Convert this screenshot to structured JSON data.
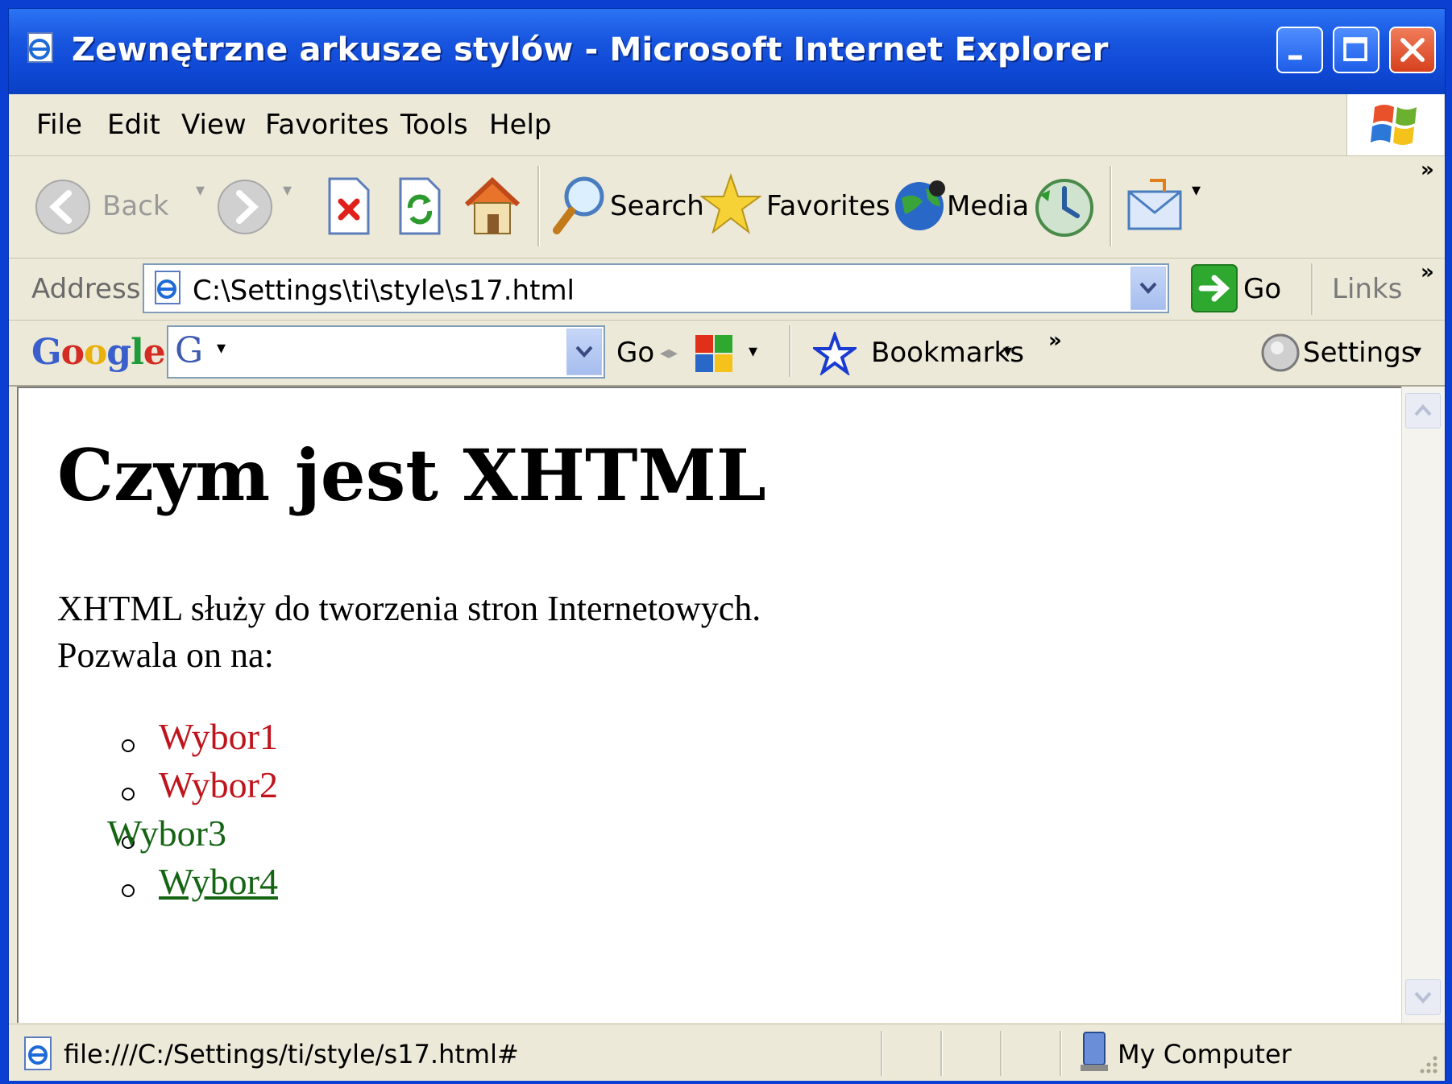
{
  "window": {
    "title": "Zewnętrzne arkusze stylów - Microsoft Internet Explorer"
  },
  "menu": {
    "items": [
      "File",
      "Edit",
      "View",
      "Favorites",
      "Tools",
      "Help"
    ]
  },
  "toolbar": {
    "back_label": "Back",
    "search_label": "Search",
    "favorites_label": "Favorites",
    "media_label": "Media",
    "overflow": "»"
  },
  "address": {
    "label": "Address",
    "value": "C:\\Settings\\ti\\style\\s17.html",
    "go_label": "Go",
    "links_label": "Links",
    "overflow": "»"
  },
  "google_toolbar": {
    "logo_letters": [
      "G",
      "o",
      "o",
      "g",
      "l",
      "e"
    ],
    "logo_colors": [
      "#3a5fcd",
      "#d42b22",
      "#e8b10b",
      "#3a5fcd",
      "#1f9a3a",
      "#d42b22"
    ],
    "search_value": "",
    "search_g": "G",
    "go_label": "Go",
    "bookmarks_label": "Bookmarks",
    "overflow": "»",
    "settings_label": "Settings"
  },
  "page": {
    "heading": "Czym jest XHTML",
    "paragraph_line1": "XHTML służy do tworzenia stron Internetowych.",
    "paragraph_line2": "Pozwala on na:",
    "list_items": [
      "Wybor1",
      "Wybor2",
      "Wybor3",
      "Wybor4"
    ]
  },
  "status": {
    "url": "file:///C:/Settings/ti/style/s17.html#",
    "zone": "My Computer"
  },
  "colors": {
    "titlebar": "#0f49d6",
    "chrome": "#ece9d8",
    "link_red": "#c0141c",
    "link_green": "#146414"
  }
}
